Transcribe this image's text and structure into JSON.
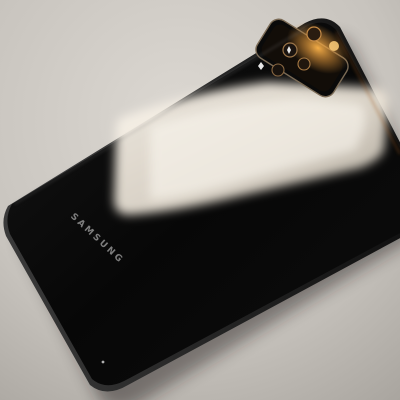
{
  "scene": {
    "subject": "smartphone-back",
    "brand_text": "SAMSUNG",
    "colors": {
      "surface": "#c9c5bf",
      "phone_body": "#070707",
      "camera_accent": "#d9923a",
      "reflection": "#f4eee4"
    }
  }
}
